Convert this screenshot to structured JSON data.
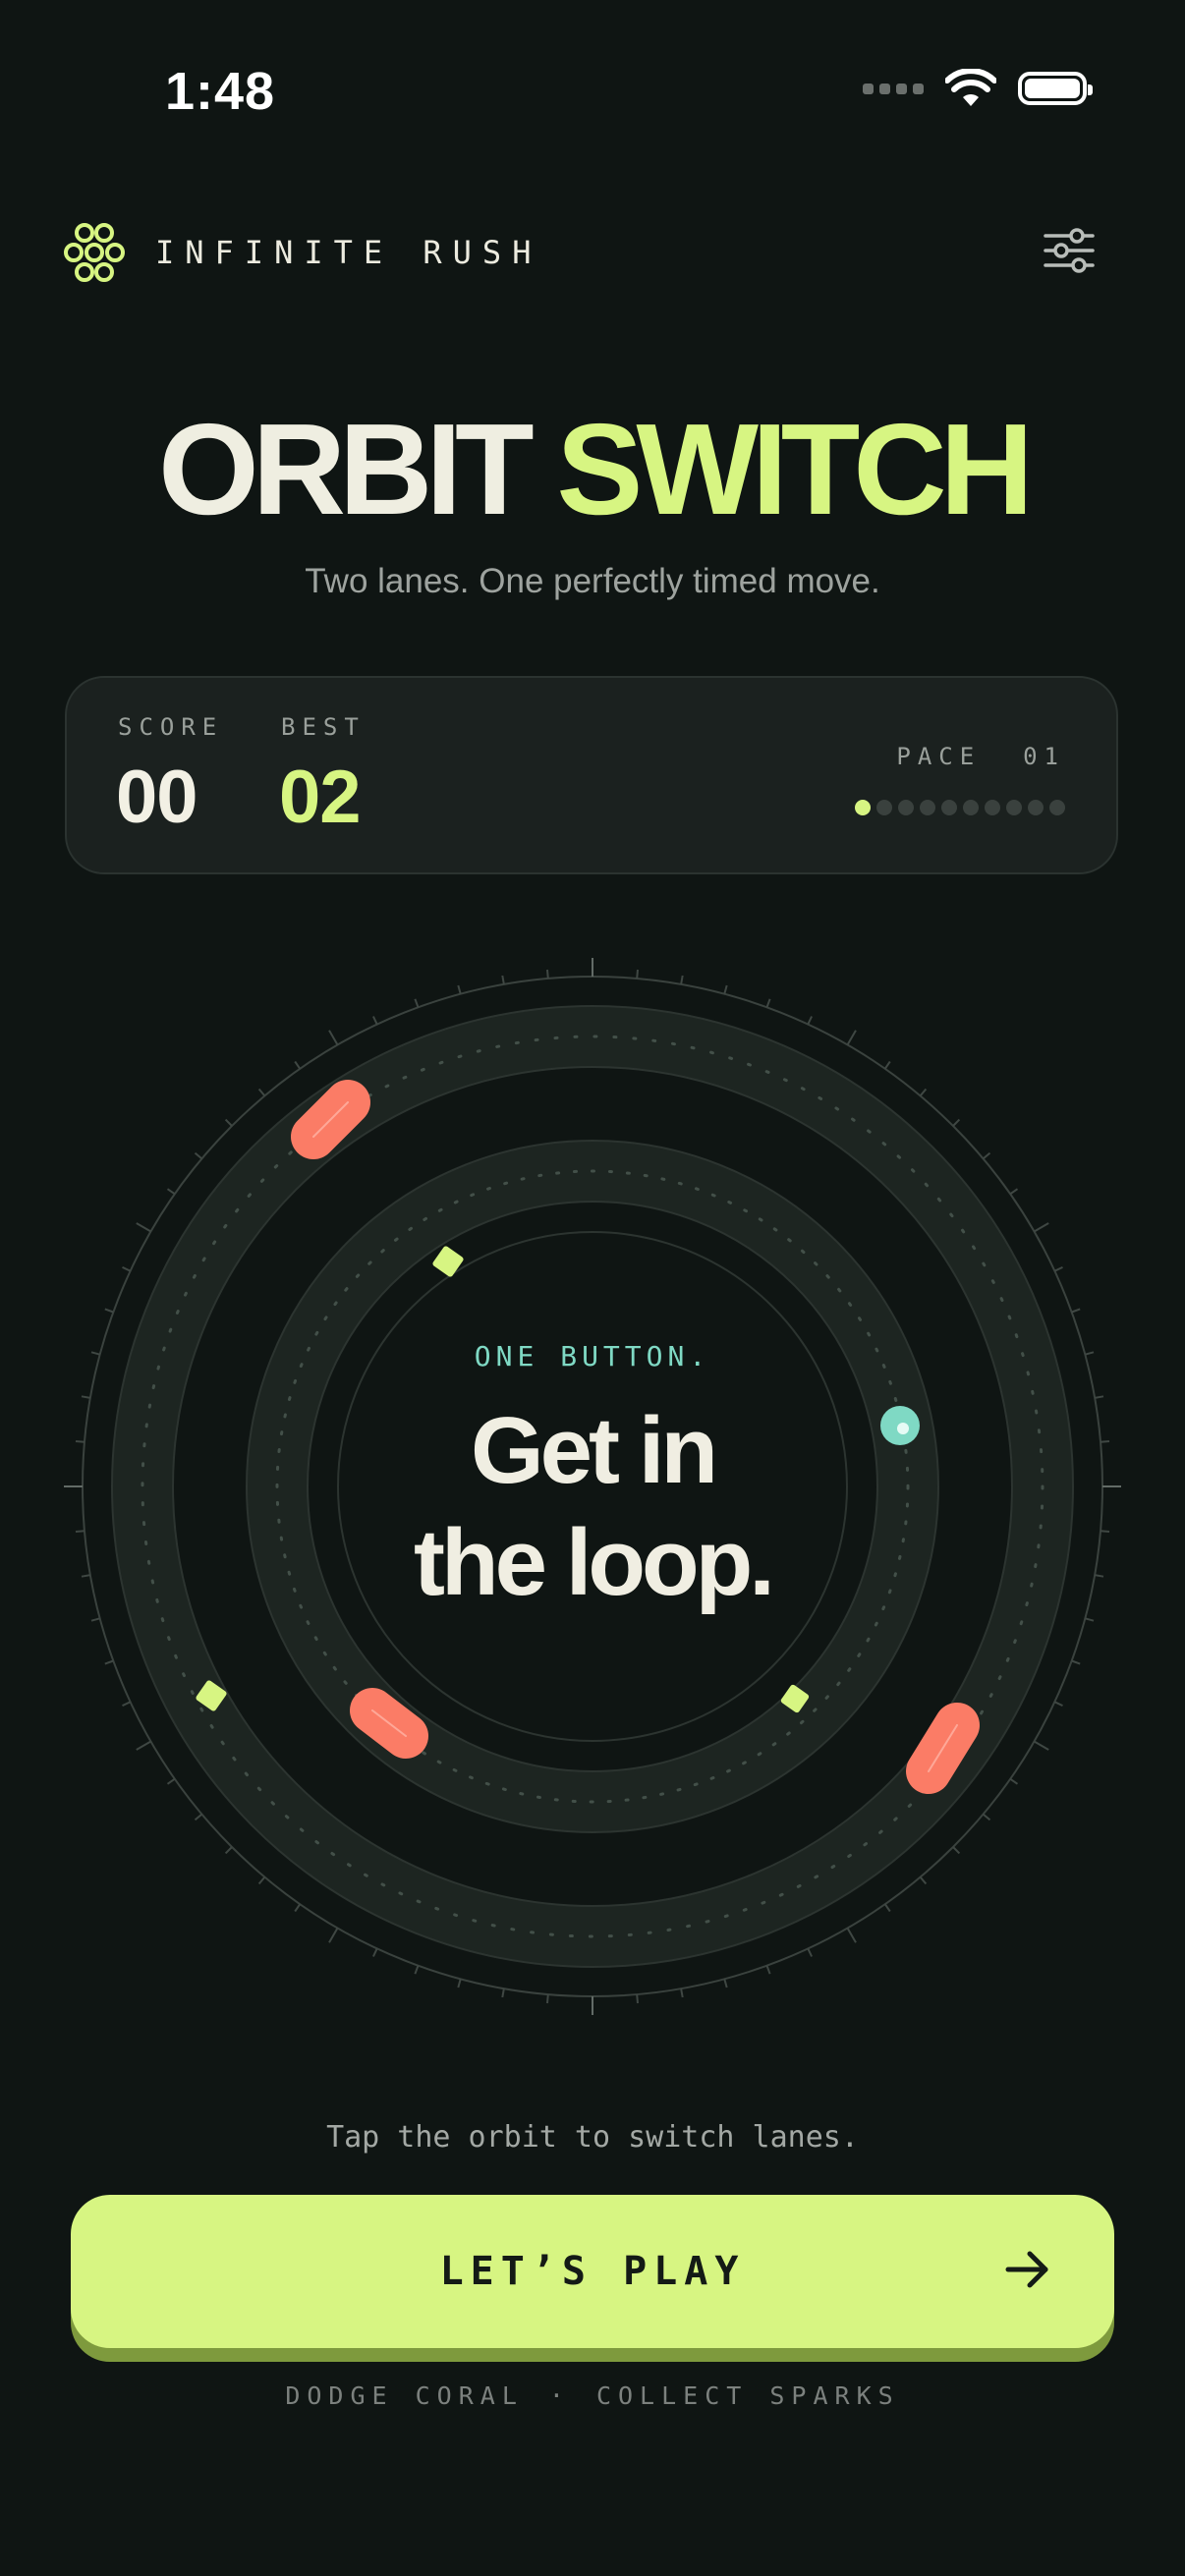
{
  "status_bar": {
    "time": "1:48"
  },
  "header": {
    "app_name": "INFINITE RUSH",
    "logo_icon": "flower-cluster-icon",
    "settings_icon": "sliders-icon"
  },
  "title": {
    "word1": "ORBIT",
    "word2": "SWITCH"
  },
  "subtitle": "Two lanes. One perfectly timed move.",
  "scoreboard": {
    "score_label": "SCORE",
    "score": "00",
    "best_label": "BEST",
    "best": "02",
    "pace_label": "PACE",
    "pace_value": "01",
    "pace_level": 1,
    "pace_max": 10
  },
  "orbit": {
    "eyebrow": "ONE BUTTON.",
    "headline_line1": "Get in",
    "headline_line2": "the loop."
  },
  "hint": "Tap the orbit to switch lanes.",
  "play_button": {
    "label": "LET’S PLAY",
    "icon": "arrow-right-icon"
  },
  "footer": {
    "left": "DODGE CORAL",
    "separator": "·",
    "right": "COLLECT SPARKS"
  },
  "colors": {
    "background": "#0f1513",
    "accent": "#d7f582",
    "coral": "#fb7c66",
    "teal": "#7fd9c4"
  }
}
